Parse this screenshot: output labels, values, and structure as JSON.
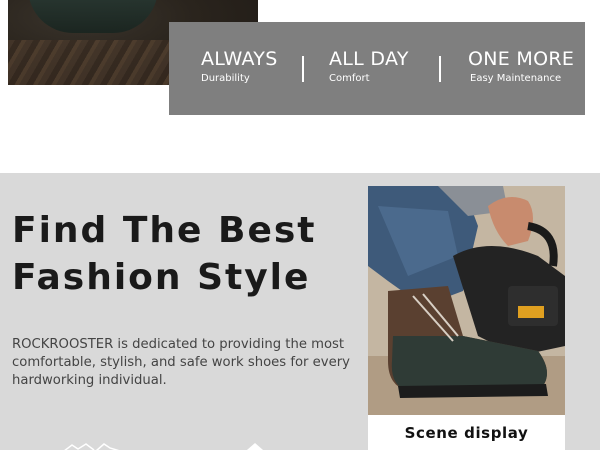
{
  "features": [
    {
      "title": "ALWAYS",
      "subtitle": "Durability"
    },
    {
      "title": "ALL DAY",
      "subtitle": "Comfort"
    },
    {
      "title": "ONE MORE",
      "subtitle": "Easy Maintenance"
    }
  ],
  "headline": {
    "line1": "Find The Best",
    "line2": "Fashion Style"
  },
  "description": "ROCKROOSTER is dedicated to providing the most comfortable, stylish, and safe work shoes for every hardworking individual.",
  "scene": {
    "label": "Scene display"
  },
  "icons": {
    "top_photo": "boot-photo",
    "scene_photo": "chainsaw-boot-photo",
    "bottom_left": "mountain-icon",
    "bottom_right": "shoe-icon"
  },
  "colors": {
    "feature_bar": "#7f7f7f",
    "section_bg": "#d9d9d9",
    "headline": "#1a1a1a",
    "body_text": "#444444"
  }
}
